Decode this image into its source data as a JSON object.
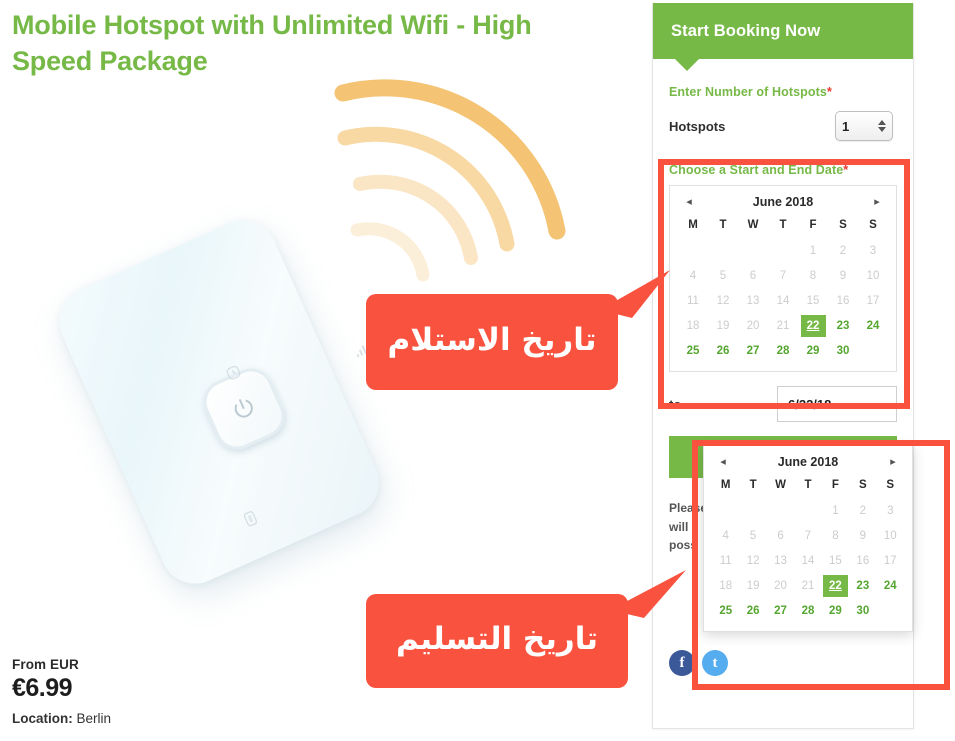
{
  "product": {
    "title": "Mobile Hotspot with Unlimited Wifi - High Speed Package",
    "price_prefix": "From EUR",
    "price": "€6.99",
    "location_label": "Location:",
    "location_value": "Berlin"
  },
  "booking": {
    "header_title": "Start Booking Now",
    "hotspots_label": "Enter Number of Hotspots",
    "required_mark": "*",
    "hotspots_row_label": "Hotspots",
    "hotspots_value": "1",
    "date_label": "Choose a Start and End Date",
    "to_label": "to",
    "end_date_value": "6/22/18",
    "cta_label": "",
    "note_line1": "Please",
    "note_line2": "will",
    "note_line3": "poss"
  },
  "calendar": {
    "month_title": "June 2018",
    "prev_icon": "◂",
    "next_icon": "▸",
    "weekdays": [
      "M",
      "T",
      "W",
      "T",
      "F",
      "S",
      "S"
    ],
    "weeks": [
      [
        {
          "d": "",
          "s": "empty"
        },
        {
          "d": "",
          "s": "empty"
        },
        {
          "d": "",
          "s": "empty"
        },
        {
          "d": "",
          "s": "empty"
        },
        {
          "d": "1",
          "s": "dis"
        },
        {
          "d": "2",
          "s": "dis"
        },
        {
          "d": "3",
          "s": "dis"
        }
      ],
      [
        {
          "d": "4",
          "s": "dis"
        },
        {
          "d": "5",
          "s": "dis"
        },
        {
          "d": "6",
          "s": "dis"
        },
        {
          "d": "7",
          "s": "dis"
        },
        {
          "d": "8",
          "s": "dis"
        },
        {
          "d": "9",
          "s": "dis"
        },
        {
          "d": "10",
          "s": "dis"
        }
      ],
      [
        {
          "d": "11",
          "s": "dis"
        },
        {
          "d": "12",
          "s": "dis"
        },
        {
          "d": "13",
          "s": "dis"
        },
        {
          "d": "14",
          "s": "dis"
        },
        {
          "d": "15",
          "s": "dis"
        },
        {
          "d": "16",
          "s": "dis"
        },
        {
          "d": "17",
          "s": "dis"
        }
      ],
      [
        {
          "d": "18",
          "s": "dis"
        },
        {
          "d": "19",
          "s": "dis"
        },
        {
          "d": "20",
          "s": "dis"
        },
        {
          "d": "21",
          "s": "dis"
        },
        {
          "d": "22",
          "s": "sel"
        },
        {
          "d": "23",
          "s": "ena"
        },
        {
          "d": "24",
          "s": "ena"
        }
      ],
      [
        {
          "d": "25",
          "s": "ena"
        },
        {
          "d": "26",
          "s": "ena"
        },
        {
          "d": "27",
          "s": "ena"
        },
        {
          "d": "28",
          "s": "ena"
        },
        {
          "d": "29",
          "s": "ena"
        },
        {
          "d": "30",
          "s": "ena"
        },
        {
          "d": "",
          "s": "empty"
        }
      ]
    ]
  },
  "social": {
    "facebook_glyph": "f",
    "twitter_glyph": "t"
  },
  "annotations": {
    "callout_1_text": "تاريخ الاستلام",
    "callout_2_text": "تاريخ التسليم"
  },
  "colors": {
    "brand_green": "#76b947",
    "annotation_red": "#f9533f",
    "required_red": "#e8372c",
    "wifi_amber": "#f3c06b"
  }
}
